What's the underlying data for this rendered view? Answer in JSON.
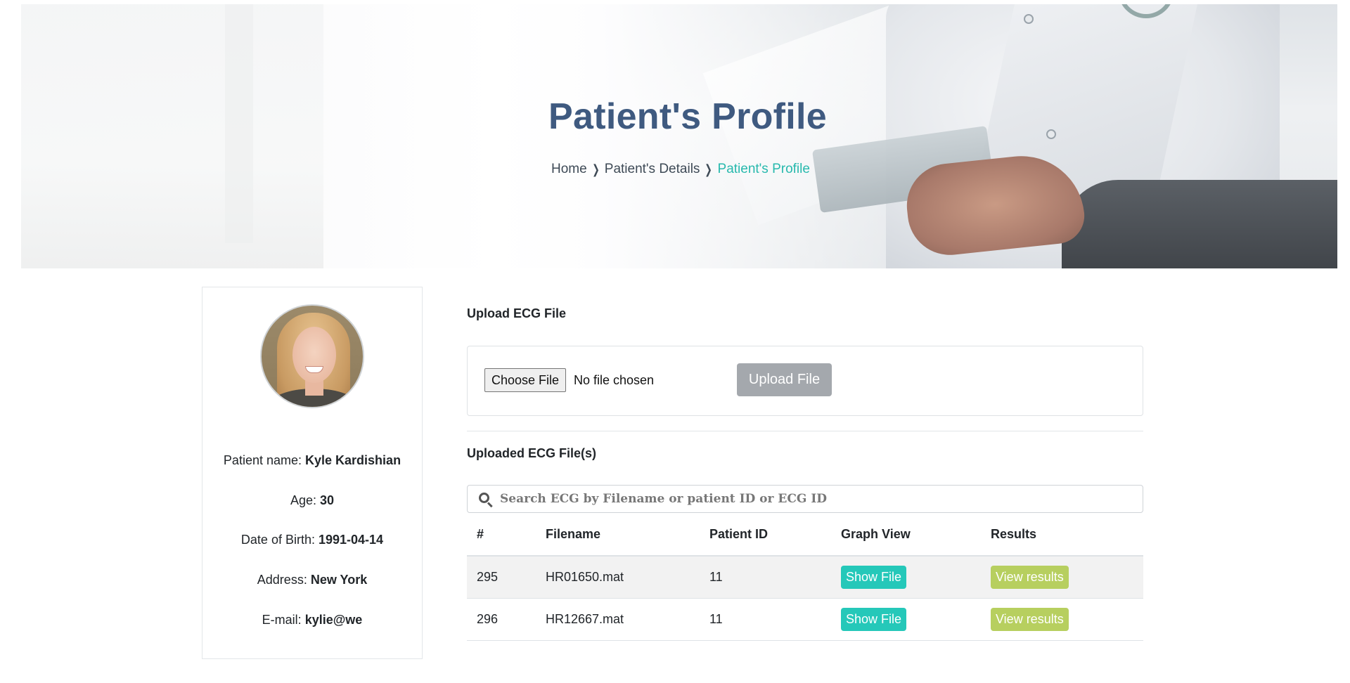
{
  "hero": {
    "title": "Patient's Profile",
    "breadcrumb": [
      {
        "label": "Home"
      },
      {
        "label": "Patient's Details"
      },
      {
        "label": "Patient's Profile"
      }
    ]
  },
  "profile": {
    "fields": [
      {
        "label": "Patient name:",
        "value": "Kyle Kardishian"
      },
      {
        "label": "Age:",
        "value": "30"
      },
      {
        "label": "Date of Birth:",
        "value": "1991-04-14"
      },
      {
        "label": "Address:",
        "value": "New York"
      },
      {
        "label": "E-mail:",
        "value": "kylie@we"
      }
    ]
  },
  "upload": {
    "section_title": "Upload ECG File",
    "choose_label": "Choose File",
    "no_file_text": "No file chosen",
    "upload_button": "Upload File"
  },
  "uploaded": {
    "section_title": "Uploaded ECG File(s)",
    "search_placeholder": "Search ECG by Filename or patient ID or ECG ID",
    "columns": [
      "#",
      "Filename",
      "Patient ID",
      "Graph View",
      "Results"
    ],
    "rows": [
      {
        "id": "295",
        "filename": "HR01650.mat",
        "patient_id": "11",
        "graph_action": "Show File",
        "results_action": "View results"
      },
      {
        "id": "296",
        "filename": "HR12667.mat",
        "patient_id": "11",
        "graph_action": "Show File",
        "results_action": "View results"
      }
    ]
  },
  "colors": {
    "title": "#3f5a80",
    "breadcrumb_active": "#27b9ad",
    "show_button": "#25c8b9",
    "results_button": "#b7cf5f",
    "upload_button_disabled": "#a4a8ad"
  },
  "icons": [
    "search-icon",
    "chevron-right-icon",
    "avatar"
  ]
}
